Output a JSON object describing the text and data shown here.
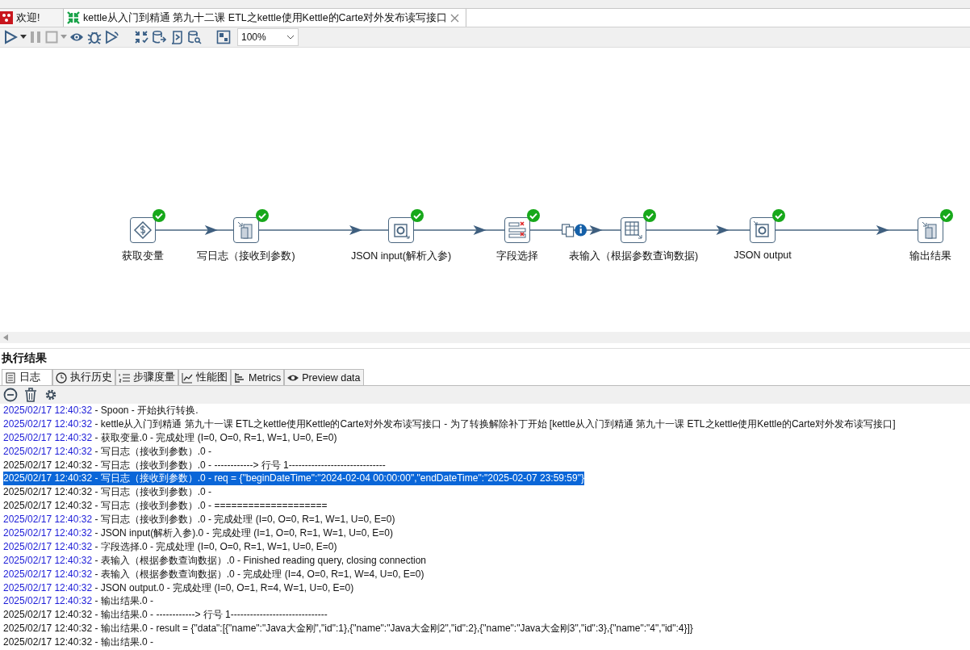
{
  "editor_tabs": [
    {
      "label": "欢迎!",
      "selected": false,
      "kind": "welcome"
    },
    {
      "label": "kettle从入门到精通 第九十二课 ETL之kettle使用Kettle的Carte对外发布读写接口",
      "selected": true,
      "kind": "transformation"
    }
  ],
  "toolbar": {
    "zoom": "100%"
  },
  "steps": [
    {
      "label": "获取变量",
      "kind": "variable",
      "finished": true
    },
    {
      "label": "写日志（接收到参数)",
      "kind": "log",
      "finished": true,
      "incoming_hop": true,
      "copy_info": false
    },
    {
      "label": "JSON input(解析入参)",
      "kind": "json-in",
      "finished": true,
      "incoming_hop": true,
      "copy_info": false
    },
    {
      "label": "字段选择",
      "kind": "select",
      "finished": true,
      "incoming_hop": true,
      "copy_info": false
    },
    {
      "label": "表输入（根据参数查询数据)",
      "kind": "table",
      "finished": true,
      "incoming_hop": true,
      "copy_info": true
    },
    {
      "label": "JSON output",
      "kind": "json-out",
      "finished": true,
      "incoming_hop": true,
      "copy_info": false
    },
    {
      "label": "输出结果",
      "kind": "log",
      "finished": true,
      "incoming_hop": true,
      "copy_info": false
    }
  ],
  "results": {
    "title": "执行结果",
    "tabs": [
      {
        "label": "日志",
        "kind": "log",
        "selected": true
      },
      {
        "label": "执行历史",
        "kind": "history",
        "selected": false
      },
      {
        "label": "步骤度量",
        "kind": "metrics-list",
        "selected": false
      },
      {
        "label": "性能图",
        "kind": "chart",
        "selected": false
      },
      {
        "label": "Metrics",
        "kind": "tree",
        "selected": false
      },
      {
        "label": "Preview data",
        "kind": "preview",
        "selected": false
      }
    ],
    "log": [
      {
        "time": "2025/02/17 12:40:32",
        "text": "- Spoon - 开始执行转换.",
        "kind": "basic",
        "selected": false
      },
      {
        "time": "2025/02/17 12:40:32",
        "text": "- kettle从入门到精通 第九十一课 ETL之kettle使用Kettle的Carte对外发布读写接口 - 为了转换解除补丁开始  [kettle从入门到精通 第九十一课 ETL之kettle使用Kettle的Carte对外发布读写接口]",
        "kind": "basic",
        "selected": false
      },
      {
        "time": "2025/02/17 12:40:32",
        "text": "- 获取变量.0 - 完成处理 (I=0, O=0, R=1, W=1, U=0, E=0)",
        "kind": "basic",
        "selected": false
      },
      {
        "time": "2025/02/17 12:40:32",
        "text": "- 写日志（接收到参数）.0 -",
        "kind": "basic",
        "selected": false
      },
      {
        "time": "2025/02/17 12:40:32",
        "text": "- 写日志（接收到参数）.0 - ------------> 行号 1------------------------------",
        "kind": "minimal",
        "selected": false
      },
      {
        "time": "2025/02/17 12:40:32",
        "text": "- 写日志（接收到参数）.0 - req = {\"beginDateTime\":\"2024-02-04 00:00:00\",\"endDateTime\":\"2025-02-07 23:59:59\"}",
        "selected": true
      },
      {
        "time": "2025/02/17 12:40:32",
        "text": "- 写日志（接收到参数）.0 -",
        "kind": "minimal",
        "selected": false
      },
      {
        "time": "2025/02/17 12:40:32",
        "text": "- 写日志（接收到参数）.0 - ====================",
        "kind": "minimal",
        "selected": false
      },
      {
        "time": "2025/02/17 12:40:32",
        "text": "- 写日志（接收到参数）.0 - 完成处理 (I=0, O=0, R=1, W=1, U=0, E=0)",
        "kind": "basic",
        "selected": false
      },
      {
        "time": "2025/02/17 12:40:32",
        "text": "- JSON input(解析入参).0 - 完成处理 (I=1, O=0, R=1, W=1, U=0, E=0)",
        "kind": "basic",
        "selected": false
      },
      {
        "time": "2025/02/17 12:40:32",
        "text": "- 字段选择.0 - 完成处理 (I=0, O=0, R=1, W=1, U=0, E=0)",
        "kind": "basic",
        "selected": false
      },
      {
        "time": "2025/02/17 12:40:32",
        "text": "- 表输入（根据参数查询数据）.0 - Finished reading query, closing connection",
        "kind": "basic",
        "selected": false
      },
      {
        "time": "2025/02/17 12:40:32",
        "text": "- 表输入（根据参数查询数据）.0 - 完成处理 (I=4, O=0, R=1, W=4, U=0, E=0)",
        "kind": "basic",
        "selected": false
      },
      {
        "time": "2025/02/17 12:40:32",
        "text": "- JSON output.0 - 完成处理 (I=0, O=1, R=4, W=1, U=0, E=0)",
        "kind": "basic",
        "selected": false
      },
      {
        "time": "2025/02/17 12:40:32",
        "text": "- 输出结果.0 -",
        "kind": "basic",
        "selected": false
      },
      {
        "time": "2025/02/17 12:40:32",
        "text": "- 输出结果.0 - ------------> 行号 1------------------------------",
        "kind": "minimal",
        "selected": false
      },
      {
        "time": "2025/02/17 12:40:32",
        "text": "- 输出结果.0 - result = {\"data\":[{\"name\":\"Java大金刚\",\"id\":1},{\"name\":\"Java大金刚2\",\"id\":2},{\"name\":\"Java大金刚3\",\"id\":3},{\"name\":\"4\",\"id\":4}]}",
        "kind": "minimal",
        "selected": false
      },
      {
        "time": "2025/02/17 12:40:32",
        "text": "- 输出结果.0 -",
        "kind": "minimal",
        "selected": false
      }
    ]
  }
}
